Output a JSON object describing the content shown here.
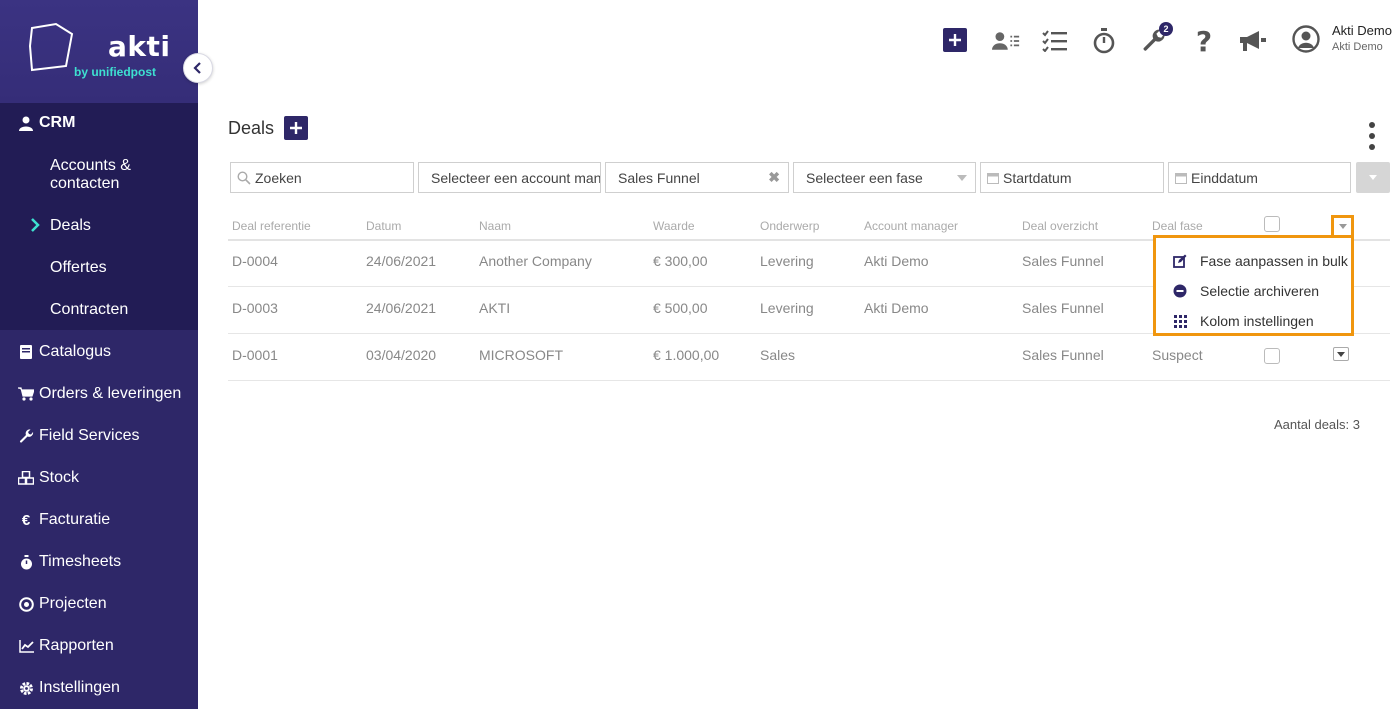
{
  "brand": {
    "name": "akti",
    "tagline": "by unifiedpost"
  },
  "sidebar": {
    "crm_label": "CRM",
    "crm_items": [
      {
        "label": "Accounts & contacten"
      },
      {
        "label": "Deals"
      },
      {
        "label": "Offertes"
      },
      {
        "label": "Contracten"
      }
    ],
    "items": [
      {
        "label": "Catalogus",
        "icon": "book-icon"
      },
      {
        "label": "Orders & leveringen",
        "icon": "cart-icon"
      },
      {
        "label": "Field Services",
        "icon": "wrench-icon"
      },
      {
        "label": "Stock",
        "icon": "boxes-icon"
      },
      {
        "label": "Facturatie",
        "icon": "euro-icon"
      },
      {
        "label": "Timesheets",
        "icon": "stopwatch-icon"
      },
      {
        "label": "Projecten",
        "icon": "target-icon"
      },
      {
        "label": "Rapporten",
        "icon": "chart-icon"
      },
      {
        "label": "Instellingen",
        "icon": "gear-icon"
      }
    ],
    "active": "Deals"
  },
  "topbar": {
    "notification_count": "2",
    "user_name": "Akti Demo",
    "user_company": "Akti Demo"
  },
  "page": {
    "title": "Deals"
  },
  "filters": {
    "search_placeholder": "Zoeken",
    "account_manager_placeholder": "Selecteer een account manager",
    "funnel_value": "Sales Funnel",
    "phase_placeholder": "Selecteer een fase",
    "start_placeholder": "Startdatum",
    "end_placeholder": "Einddatum"
  },
  "table": {
    "headers": [
      "Deal referentie",
      "Datum",
      "Naam",
      "Waarde",
      "Onderwerp",
      "Account manager",
      "Deal overzicht",
      "Deal fase"
    ],
    "rows": [
      {
        "ref": "D-0004",
        "date": "24/06/2021",
        "name": "Another Company",
        "value": "€ 300,00",
        "subject": "Levering",
        "manager": "Akti Demo",
        "overview": "Sales Funnel",
        "phase": ""
      },
      {
        "ref": "D-0003",
        "date": "24/06/2021",
        "name": "AKTI",
        "value": "€ 500,00",
        "subject": "Levering",
        "manager": "Akti Demo",
        "overview": "Sales Funnel",
        "phase": ""
      },
      {
        "ref": "D-0001",
        "date": "03/04/2020",
        "name": "MICROSOFT",
        "value": "€ 1.000,00",
        "subject": "Sales",
        "manager": "",
        "overview": "Sales Funnel",
        "phase": "Suspect"
      }
    ]
  },
  "bulk_menu": {
    "items": [
      {
        "label": "Fase aanpassen in bulk",
        "icon": "edit-icon"
      },
      {
        "label": "Selectie archiveren",
        "icon": "minus-circle-icon"
      },
      {
        "label": "Kolom instellingen",
        "icon": "grid-icon"
      }
    ]
  },
  "footer": {
    "count_text": "Aantal deals: 3"
  },
  "colors": {
    "sidebar": "#2e2768",
    "sidebar_active": "#221c55",
    "accent": "#3ee0d0",
    "highlight": "#f0960e"
  }
}
